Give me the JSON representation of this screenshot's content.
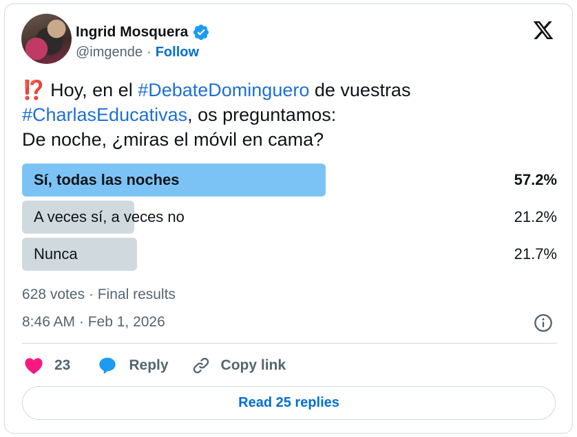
{
  "author": {
    "name": "Ingrid Mosquera",
    "handle": "@imgende",
    "separator": "·",
    "follow_label": "Follow"
  },
  "tweet": {
    "emoji": "⁉️",
    "text_1": " Hoy, en el ",
    "hashtag_1": "#DebateDominguero",
    "text_2": " de vuestras",
    "hashtag_2": "#CharlasEducativas",
    "text_3": ", os preguntamos:",
    "text_4": "De noche, ¿miras el móvil en cama?"
  },
  "poll": {
    "options": [
      {
        "label": "Sí, todas las noches",
        "percent": "57.2%",
        "fraction": 0.572,
        "winner": true
      },
      {
        "label": "A veces sí, a veces no",
        "percent": "21.2%",
        "fraction": 0.212,
        "winner": false
      },
      {
        "label": "Nunca",
        "percent": "21.7%",
        "fraction": 0.217,
        "winner": false
      }
    ],
    "summary": "628 votes · Final results"
  },
  "timestamp": "8:46 AM · Feb 1, 2026",
  "actions": {
    "likes_count": "23",
    "reply_label": "Reply",
    "copy_label": "Copy link"
  },
  "read_replies_label": "Read 25 replies",
  "colors": {
    "winner_fill": "#7cc3f5",
    "loser_fill": "#cfd9de",
    "link": "#006fd6",
    "hashtag": "#1d6fd6",
    "heart": "#f91880",
    "reply_bubble": "#1d9bf0",
    "verified": "#1d9bf0"
  },
  "icons": {
    "verified": "verified-badge-icon",
    "x_logo": "x-logo-icon",
    "info": "info-icon",
    "like": "heart-icon",
    "reply": "reply-bubble-icon",
    "copy": "link-icon"
  }
}
